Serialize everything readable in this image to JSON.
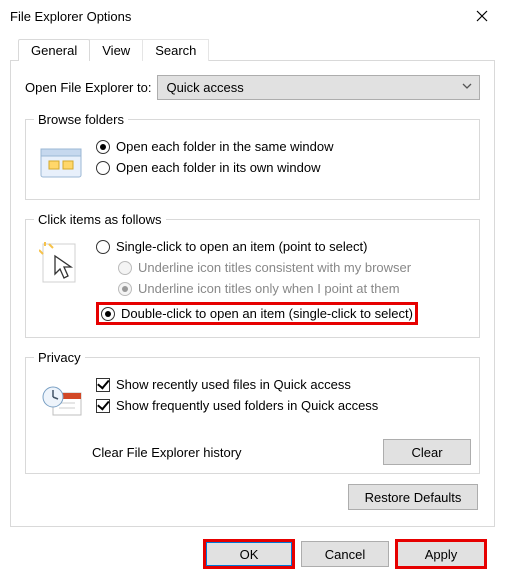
{
  "window": {
    "title": "File Explorer Options"
  },
  "tabs": {
    "general": "General",
    "view": "View",
    "search": "Search"
  },
  "openTo": {
    "label": "Open File Explorer to:",
    "value": "Quick access"
  },
  "browse": {
    "legend": "Browse folders",
    "same": "Open each folder in the same window",
    "own": "Open each folder in its own window"
  },
  "click": {
    "legend": "Click items as follows",
    "single": "Single-click to open an item (point to select)",
    "underlineBrowser": "Underline icon titles consistent with my browser",
    "underlinePoint": "Underline icon titles only when I point at them",
    "double": "Double-click to open an item (single-click to select)"
  },
  "privacy": {
    "legend": "Privacy",
    "recentFiles": "Show recently used files in Quick access",
    "frequentFolders": "Show frequently used folders in Quick access",
    "clearLabel": "Clear File Explorer history",
    "clearBtn": "Clear"
  },
  "restore": "Restore Defaults",
  "buttons": {
    "ok": "OK",
    "cancel": "Cancel",
    "apply": "Apply"
  }
}
